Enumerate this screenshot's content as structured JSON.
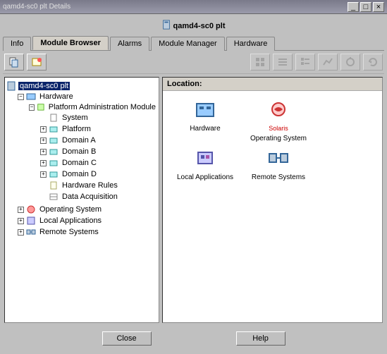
{
  "window": {
    "title": "qamd4-sc0 plt Details",
    "minimize": "_",
    "maximize": "□",
    "close": "×"
  },
  "app_title": "qamd4-sc0 plt",
  "tabs": {
    "info": "Info",
    "module_browser": "Module Browser",
    "alarms": "Alarms",
    "module_manager": "Module Manager",
    "hardware": "Hardware"
  },
  "location_label": "Location:",
  "tree": {
    "root": "qamd4-sc0 plt",
    "hardware": "Hardware",
    "platform_admin": "Platform Administration Module",
    "system": "System",
    "platform": "Platform",
    "domain_a": "Domain A",
    "domain_b": "Domain B",
    "domain_c": "Domain C",
    "domain_d": "Domain D",
    "hardware_rules": "Hardware Rules",
    "data_acquisition": "Data Acquisition",
    "operating_system": "Operating System",
    "local_applications": "Local Applications",
    "remote_systems": "Remote Systems"
  },
  "grid": {
    "hardware": "Hardware",
    "os": "Operating System",
    "os_sub": "Solaris",
    "local_apps": "Local Applications",
    "remote": "Remote Systems"
  },
  "footer": {
    "close": "Close",
    "help": "Help"
  }
}
